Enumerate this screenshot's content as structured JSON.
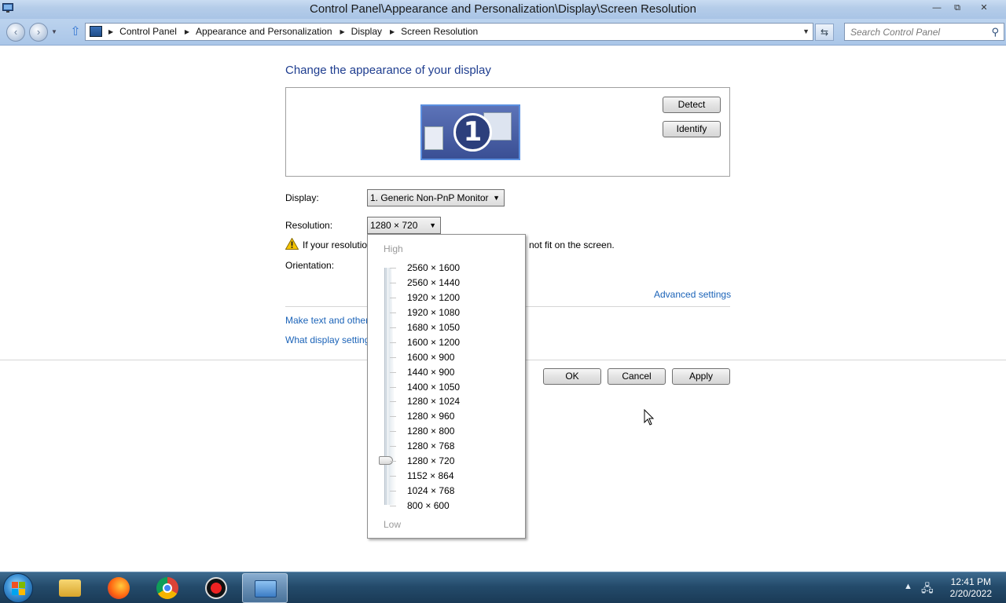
{
  "window": {
    "title": "Control Panel\\Appearance and Personalization\\Display\\Screen Resolution",
    "minimize": "▭",
    "restore": "⧉",
    "close": "✕"
  },
  "address_bar": {
    "crumbs": [
      "Control Panel",
      "Appearance and Personalization",
      "Display",
      "Screen Resolution"
    ],
    "search_placeholder": "Search Control Panel"
  },
  "page": {
    "heading": "Change the appearance of your display",
    "monitor_number": "1",
    "detect_label": "Detect",
    "identify_label": "Identify",
    "display_label": "Display:",
    "display_value": "1. Generic Non-PnP Monitor",
    "resolution_label": "Resolution:",
    "resolution_value": "1280 × 720",
    "warning_prefix": "If your resolutio",
    "warning_suffix": "not fit on the screen.",
    "orientation_label": "Orientation:",
    "advanced_link": "Advanced settings",
    "text_size_link": "Make text and other",
    "what_settings_link": "What display setting",
    "ok_label": "OK",
    "cancel_label": "Cancel",
    "apply_label": "Apply"
  },
  "resolution_dropdown": {
    "high_label": "High",
    "low_label": "Low",
    "options": [
      "2560 × 1600",
      "2560 × 1440",
      "1920 × 1200",
      "1920 × 1080",
      "1680 × 1050",
      "1600 × 1200",
      "1600 × 900",
      "1440 × 900",
      "1400 × 1050",
      "1280 × 1024",
      "1280 × 960",
      "1280 × 800",
      "1280 × 768",
      "1280 × 720",
      "1152 × 864",
      "1024 × 768",
      "800 × 600"
    ],
    "selected": "1280 × 720"
  },
  "taskbar": {
    "time": "12:41 PM",
    "date": "2/20/2022",
    "items": [
      "explorer-icon",
      "firefox-icon",
      "chrome-icon",
      "recorder-icon",
      "control-panel-icon"
    ]
  },
  "colors": {
    "heading": "#1e3d8f",
    "link": "#1b63b8",
    "taskbar": "#244b6b"
  }
}
